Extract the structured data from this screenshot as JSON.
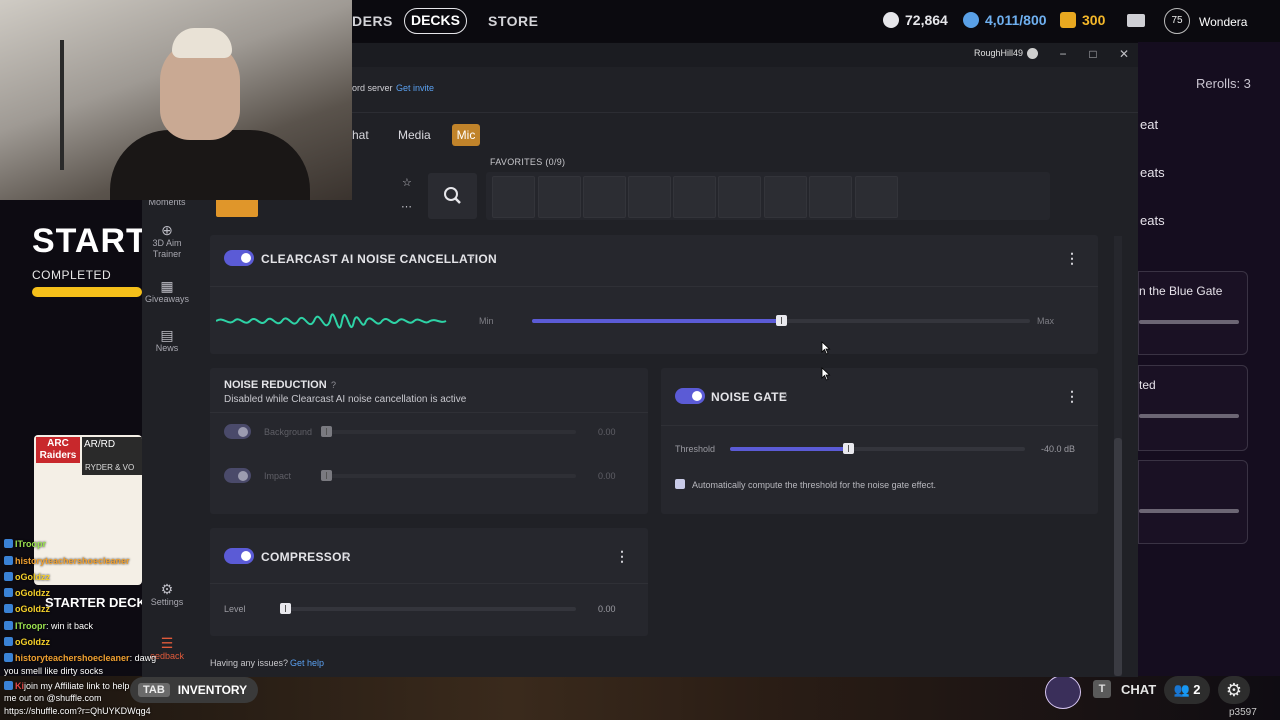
{
  "game": {
    "nav": {
      "raiders": "DERS",
      "decks": "DECKS",
      "store": "STORE"
    },
    "currencies": {
      "coins": "72,864",
      "creds": "4,011/800",
      "tokens": "300"
    },
    "profile": {
      "level": "75",
      "name": "Wondera"
    },
    "left": {
      "title": "START",
      "completed": "COMPLETED",
      "starter_deck": "STARTER DECK",
      "card": {
        "logo": "ARC Raiders",
        "code": "AR/RD",
        "strip": "RYDER & VO"
      }
    },
    "right": {
      "rerolls": "Rerolls: 3",
      "items": [
        "eat",
        "eats",
        "eats"
      ],
      "cards": [
        "n the Blue Gate",
        "ted",
        ""
      ]
    },
    "bottom": {
      "tab_key": "TAB",
      "inventory": "INVENTORY",
      "chat_key": "T",
      "chat": "CHAT",
      "friends_count": "2",
      "build": "p3597"
    }
  },
  "app": {
    "titlebar": {
      "user": "RoughHill49",
      "minimize": "−",
      "maximize": "□",
      "close": "✕"
    },
    "header": {
      "discord_text": "ord server",
      "get_invite": "Get invite"
    },
    "tabs": {
      "chat": "hat",
      "media": "Media",
      "mic": "Mic"
    },
    "sidebar": [
      {
        "label": "Moments",
        "icon": "moments-icon"
      },
      {
        "label": "3D Aim Trainer",
        "icon": "target-icon"
      },
      {
        "label": "Giveaways",
        "icon": "gift-icon"
      },
      {
        "label": "News",
        "icon": "news-icon"
      },
      {
        "label": "Settings",
        "icon": "gear-icon"
      },
      {
        "label": "eedback",
        "icon": "feedback-icon"
      }
    ],
    "favorites_label": "FAVORITES (0/9)",
    "clearcast": {
      "title": "CLEARCAST AI NOISE CANCELLATION",
      "help": "?",
      "min": "Min",
      "max": "Max",
      "level": 0.5
    },
    "noise_reduction": {
      "title": "NOISE REDUCTION",
      "help": "?",
      "subtitle": "Disabled while Clearcast AI noise cancellation is active",
      "background": {
        "label": "Background",
        "value": "0.00"
      },
      "impact": {
        "label": "Impact",
        "value": "0.00"
      }
    },
    "noise_gate": {
      "title": "NOISE GATE",
      "help": "?",
      "threshold_label": "Threshold",
      "threshold_value": "-40.0 dB",
      "threshold_level": 0.4,
      "auto_label": "Automatically compute the threshold for the noise gate effect."
    },
    "compressor": {
      "title": "COMPRESSOR",
      "help": "?",
      "level_label": "Level",
      "level_value": "0.00"
    },
    "footer": {
      "text": "Having any issues?",
      "link": "Get help"
    }
  },
  "chat": [
    {
      "user": "ITroopr",
      "msg": "",
      "cls": "u-green"
    },
    {
      "user": "historyteachershoecleaner",
      "msg": "",
      "cls": "u-orange"
    },
    {
      "user": "oGoldzz",
      "msg": "",
      "cls": "u-yellow"
    },
    {
      "user": "oGoldzz",
      "msg": "",
      "cls": "u-yellow"
    },
    {
      "user": "oGoldzz",
      "msg": "",
      "cls": "u-yellow"
    },
    {
      "user": "ITroopr",
      "msg": ": win it back",
      "cls": "u-green"
    },
    {
      "user": "oGoldzz",
      "msg": "",
      "cls": "u-yellow"
    },
    {
      "user": "historyteachershoecleaner",
      "msg": ": dawg",
      "cls": "u-orange"
    },
    {
      "user": "",
      "msg": "you smell like dirty socks",
      "cls": ""
    },
    {
      "user": "Ki",
      "msg": "join my Affiliate link to help",
      "cls": "u-red"
    },
    {
      "user": "",
      "msg": "me out on @shuffle.com",
      "cls": ""
    },
    {
      "user": "",
      "msg": "https://shuffle.com?r=QhUYKDWqg4",
      "cls": ""
    }
  ]
}
